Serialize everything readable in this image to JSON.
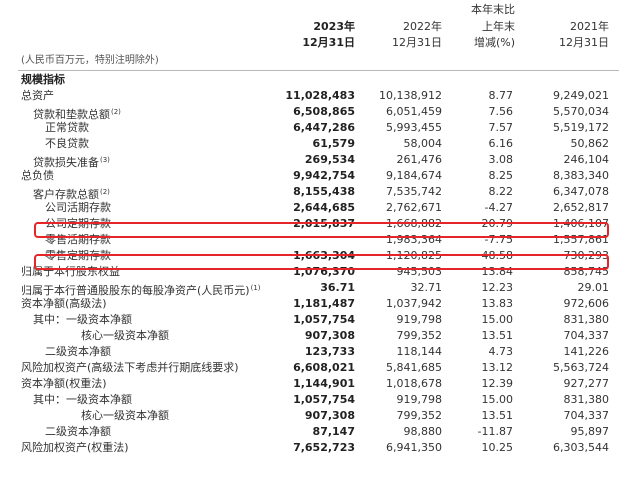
{
  "header": {
    "unit_note": "(人民币百万元，特别注明除外)",
    "col2023_year": "2023年",
    "col2023_date": "12月31日",
    "col2022_year": "2022年",
    "col2022_date": "12月31日",
    "change_line1": "本年末比",
    "change_line2": "上年末",
    "change_line3": "增减(%)",
    "col2021_year": "2021年",
    "col2021_date": "12月31日"
  },
  "rows": [
    {
      "label": "规模指标",
      "indent": 0,
      "bold": true,
      "sup": "",
      "v2023": "",
      "v2022": "",
      "chg": "",
      "v2021": ""
    },
    {
      "label": "总资产",
      "indent": 0,
      "bold": false,
      "sup": "",
      "v2023": "11,028,483",
      "v2022": "10,138,912",
      "chg": "8.77",
      "v2021": "9,249,021"
    },
    {
      "label": "贷款和垫款总额",
      "indent": 1,
      "bold": false,
      "sup": "(2)",
      "v2023": "6,508,865",
      "v2022": "6,051,459",
      "chg": "7.56",
      "v2021": "5,570,034"
    },
    {
      "label": "正常贷款",
      "indent": 2,
      "bold": false,
      "sup": "",
      "v2023": "6,447,286",
      "v2022": "5,993,455",
      "chg": "7.57",
      "v2021": "5,519,172"
    },
    {
      "label": "不良贷款",
      "indent": 2,
      "bold": false,
      "sup": "",
      "v2023": "61,579",
      "v2022": "58,004",
      "chg": "6.16",
      "v2021": "50,862"
    },
    {
      "label": "贷款损失准备",
      "indent": 1,
      "bold": false,
      "sup": "(3)",
      "v2023": "269,534",
      "v2022": "261,476",
      "chg": "3.08",
      "v2021": "246,104"
    },
    {
      "label": "总负债",
      "indent": 0,
      "bold": false,
      "sup": "",
      "v2023": "9,942,754",
      "v2022": "9,184,674",
      "chg": "8.25",
      "v2021": "8,383,340"
    },
    {
      "label": "客户存款总额",
      "indent": 1,
      "bold": false,
      "sup": "(2)",
      "v2023": "8,155,438",
      "v2022": "7,535,742",
      "chg": "8.22",
      "v2021": "6,347,078"
    },
    {
      "label": "公司活期存款",
      "indent": 2,
      "bold": false,
      "sup": "",
      "v2023": "2,644,685",
      "v2022": "2,762,671",
      "chg": "-4.27",
      "v2021": "2,652,817"
    },
    {
      "label": "公司定期存款",
      "indent": 2,
      "bold": false,
      "sup": "",
      "v2023": "2,015,837",
      "v2022": "1,668,882",
      "chg": "20.79",
      "v2021": "1,406,107"
    },
    {
      "label": "零售活期存款",
      "indent": 2,
      "bold": false,
      "sup": "",
      "v2023": "",
      "v2022": "1,983,364",
      "chg": "-7.75",
      "v2021": "1,557,861"
    },
    {
      "label": "零售定期存款",
      "indent": 2,
      "bold": false,
      "sup": "",
      "v2023": "1,663,304",
      "v2022": "1,120,825",
      "chg": "48.58",
      "v2021": "730,293"
    },
    {
      "label": "归属于本行股东权益",
      "indent": 0,
      "bold": false,
      "sup": "",
      "v2023": "1,076,370",
      "v2022": "945,503",
      "chg": "13.84",
      "v2021": "858,745"
    },
    {
      "label": "归属于本行普通股股东的每股净资产(人民币元)",
      "indent": 0,
      "bold": false,
      "sup": "(1)",
      "v2023": "36.71",
      "v2022": "32.71",
      "chg": "12.23",
      "v2021": "29.01"
    },
    {
      "label": "资本净额(高级法)",
      "indent": 0,
      "bold": false,
      "sup": "",
      "v2023": "1,181,487",
      "v2022": "1,037,942",
      "chg": "13.83",
      "v2021": "972,606"
    },
    {
      "label": "其中：一级资本净额",
      "indent": 1,
      "bold": false,
      "sup": "",
      "v2023": "1,057,754",
      "v2022": "919,798",
      "chg": "15.00",
      "v2021": "831,380"
    },
    {
      "label": "核心一级资本净额",
      "indent": 3,
      "bold": false,
      "sup": "",
      "v2023": "907,308",
      "v2022": "799,352",
      "chg": "13.51",
      "v2021": "704,337"
    },
    {
      "label": "二级资本净额",
      "indent": 2,
      "bold": false,
      "sup": "",
      "v2023": "123,733",
      "v2022": "118,144",
      "chg": "4.73",
      "v2021": "141,226"
    },
    {
      "label": "风险加权资产(高级法下考虑并行期底线要求)",
      "indent": 0,
      "bold": false,
      "sup": "",
      "v2023": "6,608,021",
      "v2022": "5,841,685",
      "chg": "13.12",
      "v2021": "5,563,724"
    },
    {
      "label": "资本净额(权重法)",
      "indent": 0,
      "bold": false,
      "sup": "",
      "v2023": "1,144,901",
      "v2022": "1,018,678",
      "chg": "12.39",
      "v2021": "927,277"
    },
    {
      "label": "其中：一级资本净额",
      "indent": 1,
      "bold": false,
      "sup": "",
      "v2023": "1,057,754",
      "v2022": "919,798",
      "chg": "15.00",
      "v2021": "831,380"
    },
    {
      "label": "核心一级资本净额",
      "indent": 3,
      "bold": false,
      "sup": "",
      "v2023": "907,308",
      "v2022": "799,352",
      "chg": "13.51",
      "v2021": "704,337"
    },
    {
      "label": "二级资本净额",
      "indent": 2,
      "bold": false,
      "sup": "",
      "v2023": "87,147",
      "v2022": "98,880",
      "chg": "-11.87",
      "v2021": "95,897"
    },
    {
      "label": "风险加权资产(权重法)",
      "indent": 0,
      "bold": false,
      "sup": "",
      "v2023": "7,652,723",
      "v2022": "6,941,350",
      "chg": "10.25",
      "v2021": "6,303,544"
    }
  ],
  "highlight_color": "#e52528"
}
